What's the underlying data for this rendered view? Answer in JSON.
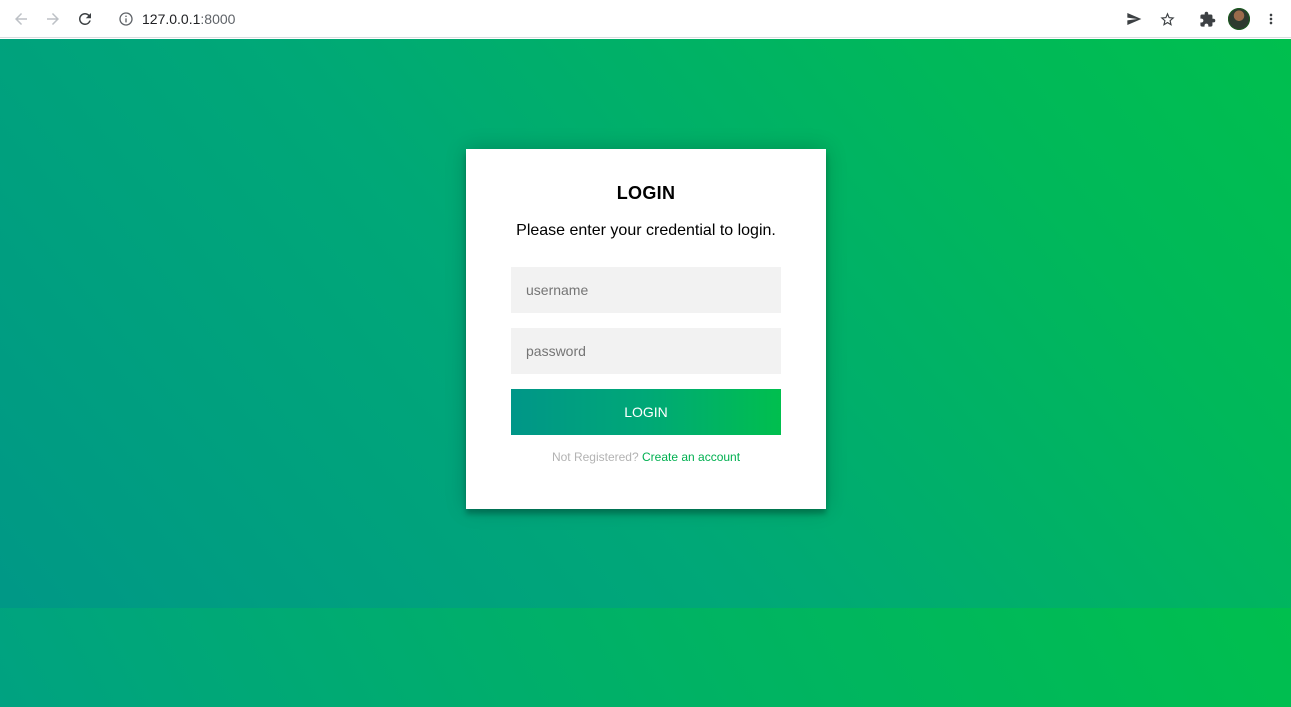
{
  "browser": {
    "url_host": "127.0.0.1",
    "url_port": ":8000",
    "icons": [
      "back-arrow-icon",
      "forward-arrow-icon",
      "reload-icon",
      "info-icon",
      "send-icon",
      "star-icon",
      "extensions-icon",
      "avatar",
      "more-vert-icon"
    ]
  },
  "login_card": {
    "title": "LOGIN",
    "subtitle": "Please enter your credential to login.",
    "username_placeholder": "username",
    "username_value": "",
    "password_placeholder": "password",
    "password_value": "",
    "submit_label": "LOGIN",
    "register_prompt": "Not Registered?",
    "register_link": "Create an account"
  },
  "colors": {
    "gradient_start": "#009688",
    "gradient_end": "#00bf4e",
    "link": "#00b050",
    "field_background": "#f2f2f2"
  }
}
